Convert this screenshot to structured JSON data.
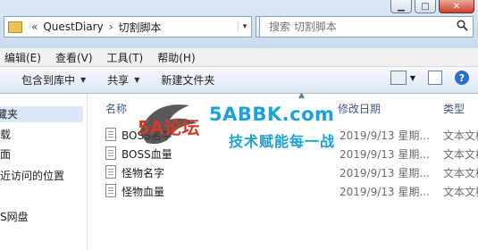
{
  "window": {
    "controls": {
      "minimize": "▁",
      "maximize": "□",
      "close": "✕"
    }
  },
  "address": {
    "overflow": "«",
    "segments": [
      "QuestDiary",
      "切割脚本"
    ],
    "separator": "›",
    "dropdown": "▾"
  },
  "refresh_glyph": "↻",
  "search": {
    "placeholder": "搜索 切割脚本"
  },
  "menu": [
    "编辑(E)",
    "查看(V)",
    "工具(T)",
    "帮助(H)"
  ],
  "toolbar": {
    "include_library": "包含到库中",
    "share": "共享",
    "new_folder": "新建文件夹",
    "help": "?"
  },
  "nav": {
    "favorites": "藏夹",
    "items": [
      "载",
      "面",
      "近访问的位置",
      "S网盘"
    ]
  },
  "columns": {
    "name": "名称",
    "modified": "修改日期",
    "type": "类型"
  },
  "files": [
    {
      "name": "BOSS名字",
      "modified": "2019/9/13 星期...",
      "type": "文本文档"
    },
    {
      "name": "BOSS血量",
      "modified": "2019/9/13 星期...",
      "type": "文本文档"
    },
    {
      "name": "怪物名字",
      "modified": "2019/9/13 星期...",
      "type": "文本文档"
    },
    {
      "name": "怪物血量",
      "modified": "2019/9/13 星期...",
      "type": "文本文档"
    }
  ],
  "watermark": {
    "logo_text": "5A论坛",
    "site": "5ABBK.com",
    "slogan": "技术赋能每一战"
  },
  "colors": {
    "accent": "#1ca2d8",
    "logo_red": "#d43a2a",
    "header_text": "#3c5a82"
  }
}
